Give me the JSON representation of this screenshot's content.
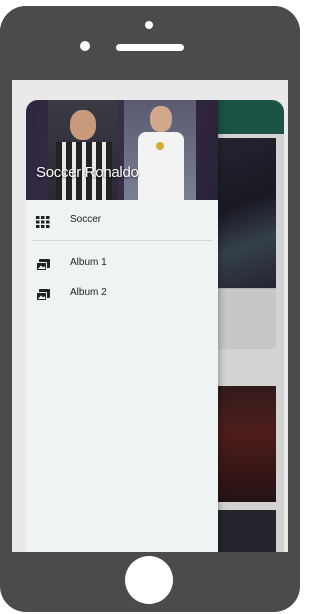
{
  "drawer": {
    "header_title": "Soccer Ronaldo",
    "items": [
      {
        "label": "Soccer",
        "icon": "grid-icon"
      },
      {
        "label": "Album 1",
        "icon": "photo-album-icon"
      },
      {
        "label": "Album 2",
        "icon": "photo-album-icon"
      }
    ]
  },
  "colors": {
    "frame": "#4b4b4b",
    "drawer_bg": "#eef4f3",
    "toolbar": "#1f5f50"
  }
}
